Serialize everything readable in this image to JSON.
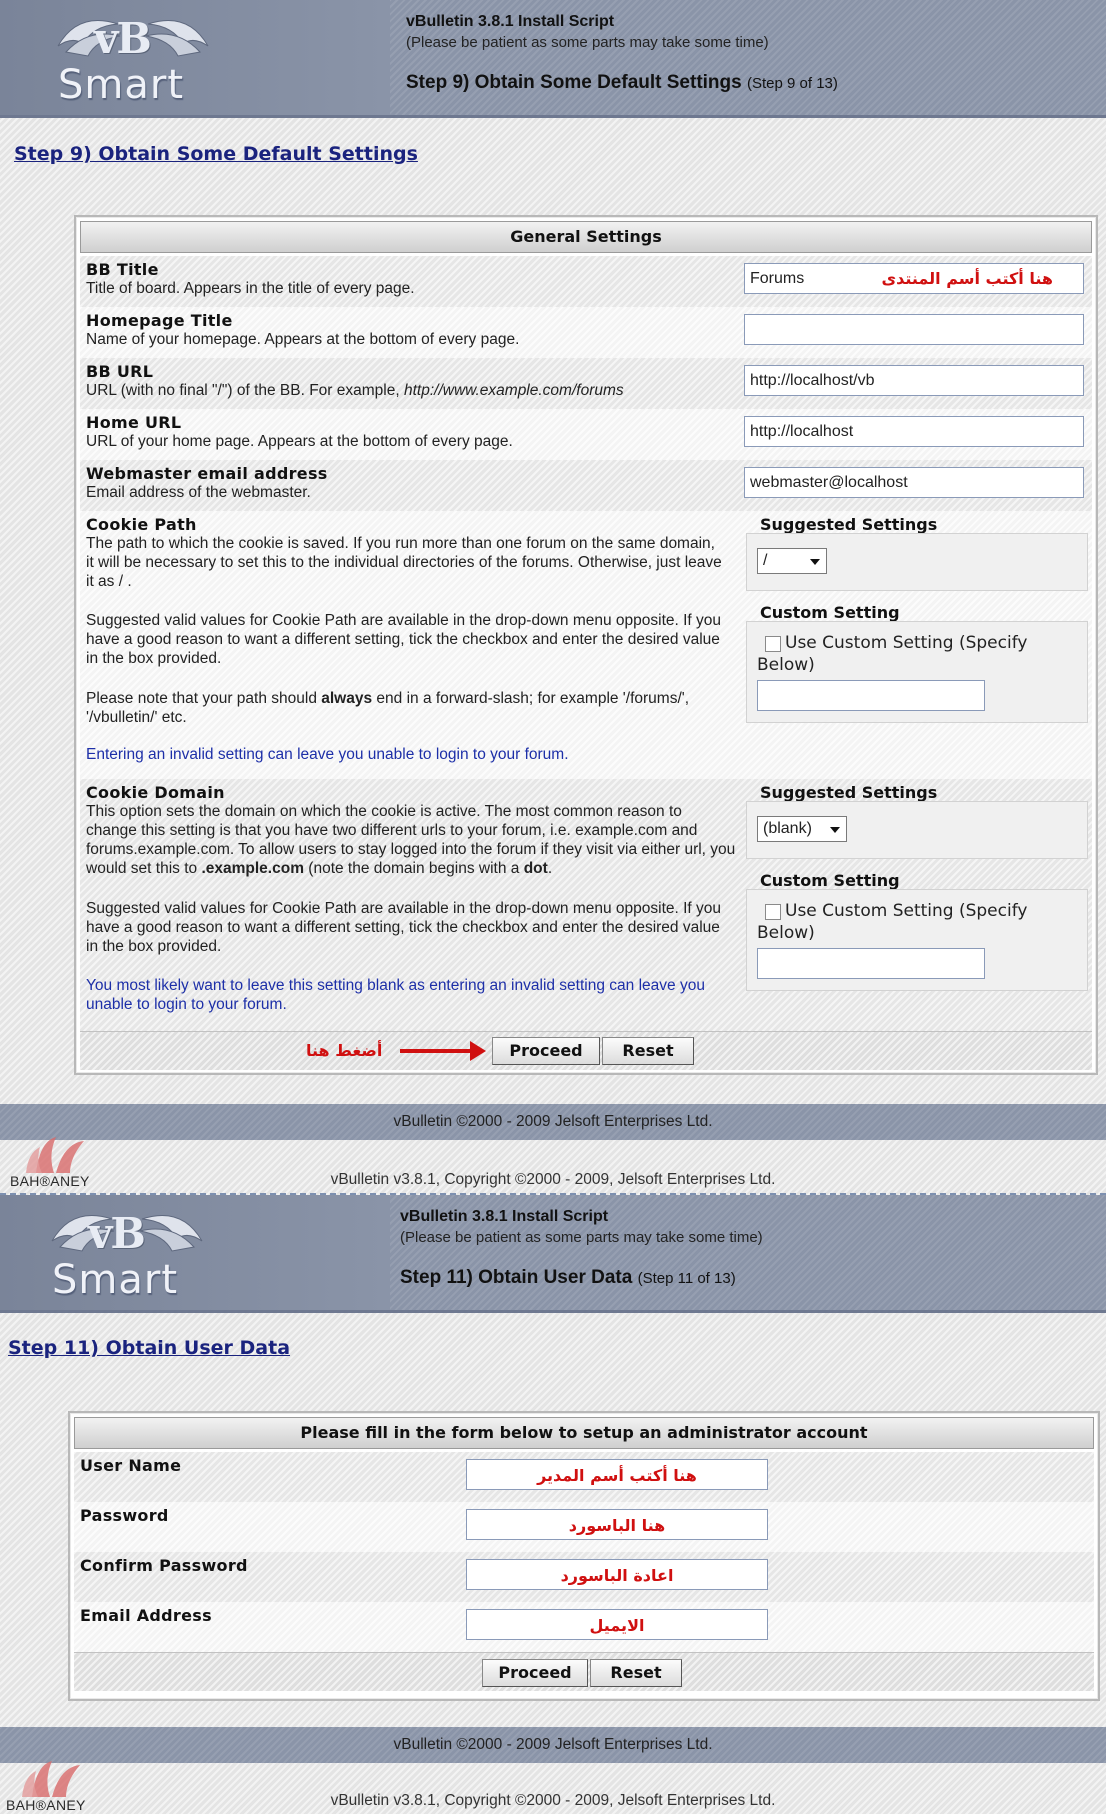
{
  "logo": {
    "vb": "vB",
    "smart": "Smart"
  },
  "watermark": "BAH®ANEY",
  "step9": {
    "header": {
      "script_name": "vBulletin 3.8.1 Install Script",
      "patience": "(Please be patient as some parts may take some time)",
      "step_title": "Step 9) Obtain Some Default Settings",
      "step_count": "(Step 9 of 13)"
    },
    "page_title": "Step 9) Obtain Some Default Settings",
    "table_title": "General Settings",
    "rows": [
      {
        "label": "BB Title",
        "desc": "Title of board. Appears in the title of every page.",
        "value": "Forums",
        "annotation": "هنا أكتب أسم المنتدى"
      },
      {
        "label": "Homepage Title",
        "desc": "Name of your homepage. Appears at the bottom of every page.",
        "value": ""
      },
      {
        "label": "BB URL",
        "desc": "URL (with no final \"/\") of the BB. For example,",
        "desc_example": "http://www.example.com/forums",
        "value": "http://localhost/vb"
      },
      {
        "label": "Home URL",
        "desc": "URL of your home page. Appears at the bottom of every page.",
        "value": "http://localhost"
      },
      {
        "label": "Webmaster email address",
        "desc": "Email address of the webmaster.",
        "value": "webmaster@localhost"
      }
    ],
    "cookie_path": {
      "label": "Cookie Path",
      "p1": "The path to which the cookie is saved. If you run more than one forum on the same domain, it will be necessary to set this to the individual directories of the forums. Otherwise, just leave it as / .",
      "p2": "Suggested valid values for Cookie Path are available in the drop-down menu opposite. If you have a good reason to want a different setting, tick the checkbox and enter the desired value in the box provided.",
      "p3_a": "Please note that your path should ",
      "p3_b": "always",
      "p3_c": " end in a forward-slash; for example '/forums/', '/vbulletin/' etc.",
      "warning": "Entering an invalid setting can leave you unable to login to your forum.",
      "suggested_title": "Suggested Settings",
      "selected": "/",
      "custom_title": "Custom Setting",
      "checkbox_label_1": "Use Custom Setting (Specify",
      "checkbox_label_2": "Below)",
      "custom_value": ""
    },
    "cookie_domain": {
      "label": "Cookie Domain",
      "p1_a": "This option sets the domain on which the cookie is active. The most common reason to change this setting is that you have two different urls to your forum, i.e. example.com and forums.example.com. To allow users to stay logged into the forum if they visit via either url, you would set this to ",
      "p1_b": ".example.com",
      "p1_c": " (note the domain begins with a ",
      "p1_d": "dot",
      "p1_e": ".",
      "p2": "Suggested valid values for Cookie Path are available in the drop-down menu opposite. If you have a good reason to want a different setting, tick the checkbox and enter the desired value in the box provided.",
      "warning": "You most likely want to leave this setting blank as entering an invalid setting can leave you unable to login to your forum.",
      "suggested_title": "Suggested Settings",
      "selected": "(blank)",
      "custom_title": "Custom Setting",
      "checkbox_label_1": "Use Custom Setting (Specify",
      "checkbox_label_2": "Below)",
      "custom_value": ""
    },
    "buttons": {
      "proceed": "Proceed",
      "reset": "Reset",
      "annotation": "أضغط هنا"
    },
    "footer": "vBulletin ©2000 - 2009 Jelsoft Enterprises Ltd.",
    "copyright": "vBulletin v3.8.1, Copyright ©2000 - 2009, Jelsoft Enterprises Ltd."
  },
  "step11": {
    "header": {
      "script_name": "vBulletin 3.8.1 Install Script",
      "patience": "(Please be patient as some parts may take some time)",
      "step_title": "Step 11) Obtain User Data",
      "step_count": "(Step 11 of 13)"
    },
    "page_title": "Step 11) Obtain User Data",
    "table_title": "Please fill in the form below to setup an administrator account",
    "fields": [
      {
        "label": "User Name",
        "value": "هنا أكتب أسم المدير"
      },
      {
        "label": "Password",
        "value": "هنا الباسورد"
      },
      {
        "label": "Confirm Password",
        "value": "اعادة الباسورد"
      },
      {
        "label": "Email Address",
        "value": "الايميل"
      }
    ],
    "buttons": {
      "proceed": "Proceed",
      "reset": "Reset"
    },
    "footer": "vBulletin ©2000 - 2009 Jelsoft Enterprises Ltd.",
    "copyright": "vBulletin v3.8.1, Copyright ©2000 - 2009, Jelsoft Enterprises Ltd."
  },
  "colors": {
    "header": "#8a94a8",
    "title_link": "#1a237e",
    "warning_text": "#1d2fa8",
    "annotation": "#d01010"
  }
}
